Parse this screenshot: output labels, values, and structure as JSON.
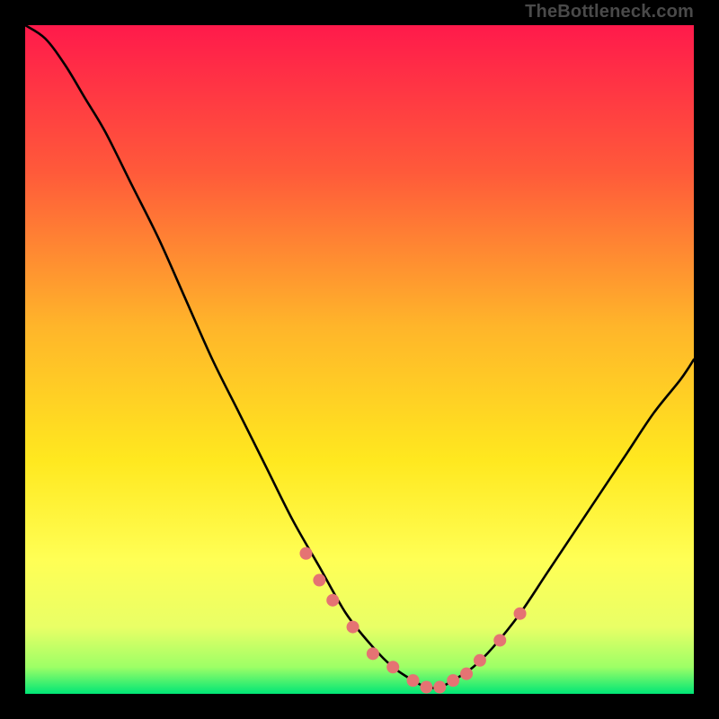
{
  "source_label": "TheBottleneck.com",
  "colors": {
    "page_bg": "#000000",
    "gradient_top": "#ff1a4b",
    "gradient_mid_upper": "#ff7a2a",
    "gradient_mid": "#ffd21f",
    "gradient_low_yellow": "#ffff55",
    "gradient_near_bottom": "#e6ff66",
    "gradient_green": "#00e676",
    "curve_stroke": "#000000",
    "marker_fill": "#e57373",
    "marker_stroke": "#cc5f5f"
  },
  "chart_data": {
    "type": "line",
    "title": "",
    "xlabel": "",
    "ylabel": "",
    "xlim": [
      0,
      100
    ],
    "ylim": [
      0,
      100
    ],
    "series": [
      {
        "name": "bottleneck-curve",
        "x": [
          0,
          3,
          6,
          9,
          12,
          16,
          20,
          24,
          28,
          32,
          36,
          40,
          44,
          48,
          52,
          55,
          58,
          60,
          62,
          64,
          67,
          70,
          74,
          78,
          82,
          86,
          90,
          94,
          98,
          100
        ],
        "y": [
          100,
          98,
          94,
          89,
          84,
          76,
          68,
          59,
          50,
          42,
          34,
          26,
          19,
          12,
          7,
          4,
          2,
          1,
          1,
          2,
          4,
          7,
          12,
          18,
          24,
          30,
          36,
          42,
          47,
          50
        ]
      }
    ],
    "markers": {
      "name": "highlight-points",
      "x": [
        42,
        44,
        46,
        49,
        52,
        55,
        58,
        60,
        62,
        64,
        66,
        68,
        71,
        74
      ],
      "y": [
        21,
        17,
        14,
        10,
        6,
        4,
        2,
        1,
        1,
        2,
        3,
        5,
        8,
        12
      ]
    }
  }
}
